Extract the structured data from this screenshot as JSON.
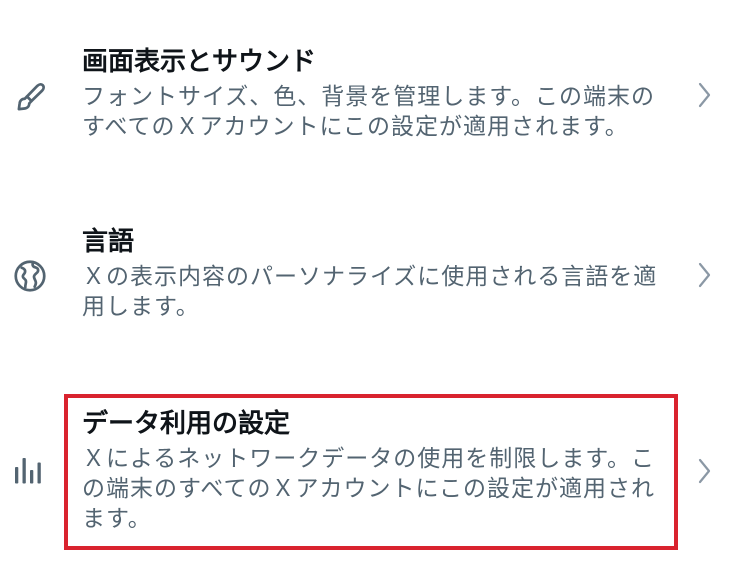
{
  "settings": {
    "items": [
      {
        "icon": "brush-icon",
        "title": "画面表示とサウンド",
        "description": "フォントサイズ、色、背景を管理します。この端末のすべてのＸアカウントにこの設定が適用されます。"
      },
      {
        "icon": "globe-icon",
        "title": "言語",
        "description": "Ｘの表示内容のパーソナライズに使用される言語を適用します。"
      },
      {
        "icon": "bar-chart-icon",
        "title": "データ利用の設定",
        "description": "Ｘによるネットワークデータの使用を制限します。この端末のすべてのＸアカウントにこの設定が適用されます。"
      }
    ]
  },
  "colors": {
    "title": "#0f1419",
    "secondary_text": "#536471",
    "chevron": "#8b98a5",
    "highlight": "#d9232e"
  }
}
